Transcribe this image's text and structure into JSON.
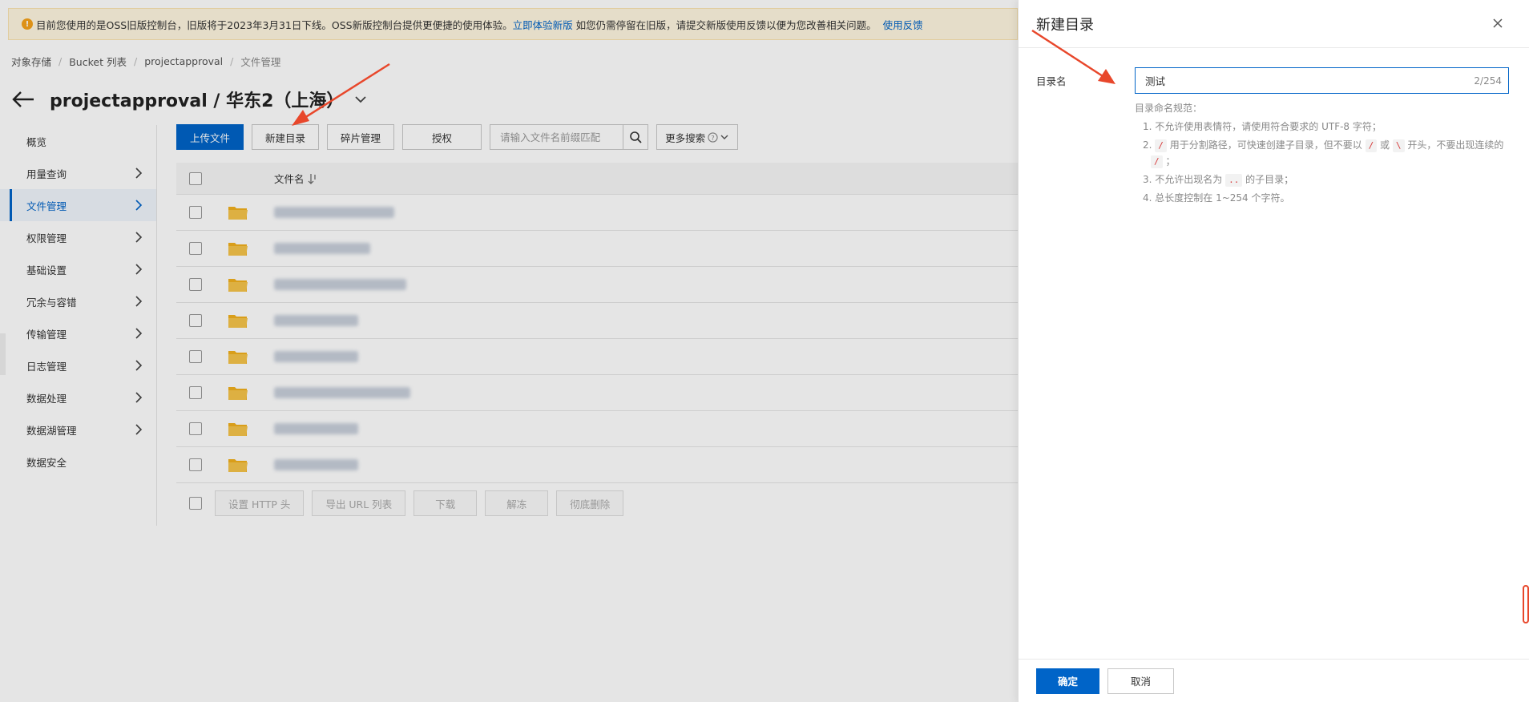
{
  "notice": {
    "text_before": "目前您使用的是OSS旧版控制台，旧版将于2023年3月31日下线。OSS新版控制台提供更便捷的使用体验。",
    "link1": "立即体验新版",
    "text_middle": "如您仍需停留在旧版，请提交新版使用反馈以便为您改善相关问题。",
    "link2": "使用反馈"
  },
  "breadcrumb": [
    "对象存储",
    "Bucket 列表",
    "projectapproval",
    "文件管理"
  ],
  "page_title": "projectapproval / 华东2（上海）",
  "sidebar": {
    "items": [
      {
        "label": "概览",
        "has_arrow": false
      },
      {
        "label": "用量查询",
        "has_arrow": true
      },
      {
        "label": "文件管理",
        "has_arrow": true,
        "active": true
      },
      {
        "label": "权限管理",
        "has_arrow": true
      },
      {
        "label": "基础设置",
        "has_arrow": true
      },
      {
        "label": "冗余与容错",
        "has_arrow": true
      },
      {
        "label": "传输管理",
        "has_arrow": true
      },
      {
        "label": "日志管理",
        "has_arrow": true
      },
      {
        "label": "数据处理",
        "has_arrow": true
      },
      {
        "label": "数据湖管理",
        "has_arrow": true
      },
      {
        "label": "数据安全",
        "has_arrow": false
      }
    ]
  },
  "toolbar": {
    "upload": "上传文件",
    "new_dir": "新建目录",
    "fragments": "碎片管理",
    "authorize": "授权",
    "search_placeholder": "请输入文件名前缀匹配",
    "more_search": "更多搜索"
  },
  "table": {
    "col_name": "文件名",
    "row_count": 8
  },
  "batch": {
    "set_http": "设置 HTTP 头",
    "export_url": "导出 URL 列表",
    "download": "下载",
    "unfreeze": "解冻",
    "delete": "彻底删除"
  },
  "drawer": {
    "title": "新建目录",
    "label": "目录名",
    "value": "测试",
    "counter": "2/254",
    "rules_title": "目录命名规范：",
    "rule1": "1. 不允许使用表情符，请使用符合要求的 UTF-8 字符；",
    "rule2_a": "2.",
    "rule2_code1": "/",
    "rule2_b": "用于分割路径，可快速创建子目录，但不要以",
    "rule2_code2": "/",
    "rule2_c": "或",
    "rule2_code3": "\\",
    "rule2_d": "开头，不要出现连续的",
    "rule2_code4": "/",
    "rule2_e": "；",
    "rule3_a": "3. 不允许出现名为",
    "rule3_code": "..",
    "rule3_b": "的子目录；",
    "rule4": "4. 总长度控制在 1~254 个字符。",
    "confirm": "确定",
    "cancel": "取消"
  },
  "colors": {
    "primary": "#0064c8",
    "notice_bg": "#fff7e0",
    "annotation_red": "#e8472b",
    "folder": "#f2b01e"
  }
}
